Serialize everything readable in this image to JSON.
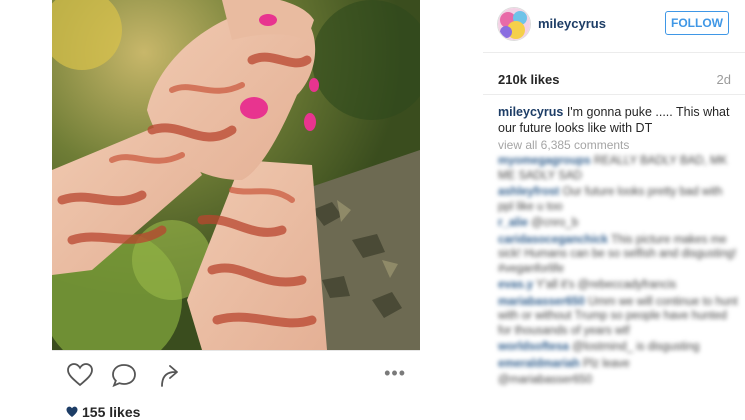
{
  "post": {
    "like_count_label": "155 likes"
  },
  "actions": {
    "more_label": "•••"
  },
  "header": {
    "username": "mileycyrus",
    "follow_label": "FOLLOW"
  },
  "stats": {
    "likes": "210k likes",
    "age": "2d"
  },
  "caption": {
    "user": "mileycyrus",
    "text": "I'm gonna puke ..... This what our future looks like with DT"
  },
  "view_all_comments": "view all 6,385 comments",
  "comments": [
    {
      "user": "myomegagroups",
      "text": "REALLY BADLY BAD, MK ME SADLY SAD"
    },
    {
      "user": "ashleyfrost",
      "text": "Our future looks pretty bad with ppl like u too"
    },
    {
      "user": "r_alie",
      "text": "@cnro_b"
    },
    {
      "user": "caridasoceganchick",
      "text": "This picture makes me sick! Humans can be so selfish and disgusting! #veganforlife"
    },
    {
      "user": "evas.y",
      "text": "Y'all it's @rebeccadyfrancis"
    },
    {
      "user": "mariabasser650",
      "text": "Umm we will continue to hunt with or without Trump so people have hunted for thousands of years wtf"
    },
    {
      "user": "worldsoftesa",
      "text": "@lostmind_ is disgusting"
    },
    {
      "user": "emeraldmariah",
      "text": "Plz leave"
    },
    {
      "user": "",
      "text": "@mariabasser650"
    }
  ],
  "colors": {
    "link_blue": "#3f97e6",
    "username_navy": "#1d3d66",
    "blood_red": "#b8452f",
    "nail_pink": "#e8348f"
  },
  "icons": [
    "heart-icon",
    "comment-bubble-icon",
    "share-arrow-icon",
    "more-options-icon",
    "avatar-image"
  ]
}
